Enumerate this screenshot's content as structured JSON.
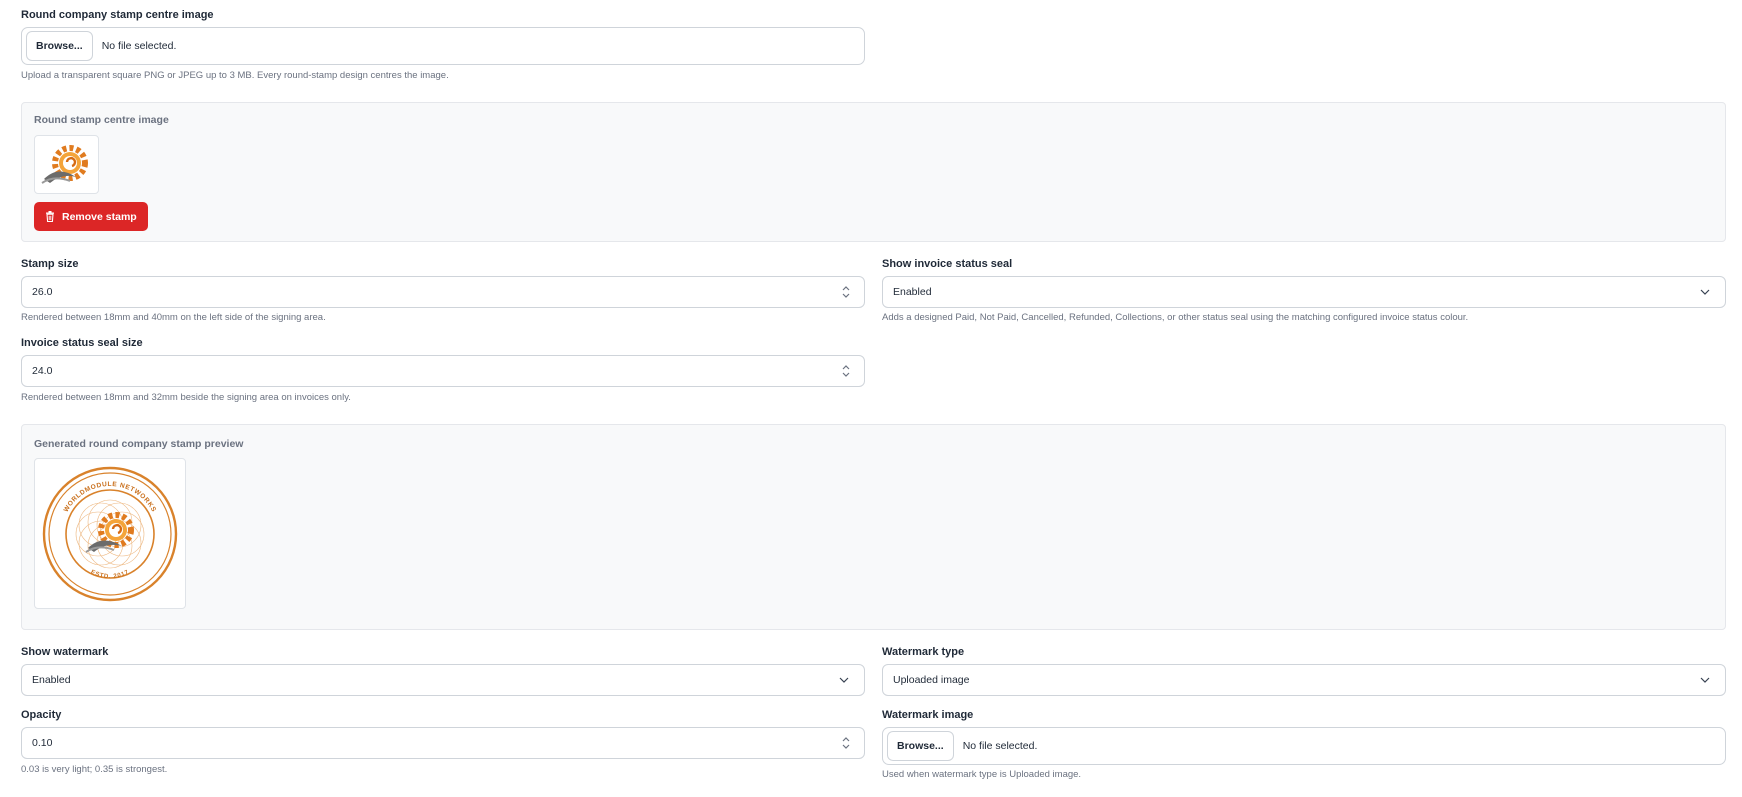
{
  "stamp_upload": {
    "label": "Round company stamp centre image",
    "browse_label": "Browse...",
    "file_status": "No file selected.",
    "help": "Upload a transparent square PNG or JPEG up to 3 MB. Every round-stamp design centres the image."
  },
  "centre_image_panel": {
    "title": "Round stamp centre image",
    "remove_label": "Remove stamp",
    "image_icon": "gear-swirl-logo"
  },
  "stamp_size": {
    "label": "Stamp size",
    "value": "26.0",
    "help": "Rendered between 18mm and 40mm on the left side of the signing area."
  },
  "status_seal": {
    "label": "Show invoice status seal",
    "selected": "Enabled",
    "help": "Adds a designed Paid, Not Paid, Cancelled, Refunded, Collections, or other status seal using the matching configured invoice status colour."
  },
  "seal_size": {
    "label": "Invoice status seal size",
    "value": "24.0",
    "help": "Rendered between 18mm and 32mm beside the signing area on invoices only."
  },
  "preview_panel": {
    "title": "Generated round company stamp preview",
    "stamp_top_text": "WORLDMODULE NETWORKS",
    "stamp_bottom_text": "ESTD. 2017"
  },
  "watermark": {
    "show_label": "Show watermark",
    "show_selected": "Enabled",
    "type_label": "Watermark type",
    "type_selected": "Uploaded image",
    "opacity_label": "Opacity",
    "opacity_value": "0.10",
    "opacity_help": "0.03 is very light; 0.35 is strongest.",
    "image_label": "Watermark image",
    "browse_label": "Browse...",
    "file_status": "No file selected.",
    "image_help": "Used when watermark type is Uploaded image."
  },
  "colors": {
    "danger": "#dc2626",
    "stamp_orange": "#d9822b",
    "panel_bg": "#f8f9fa"
  }
}
